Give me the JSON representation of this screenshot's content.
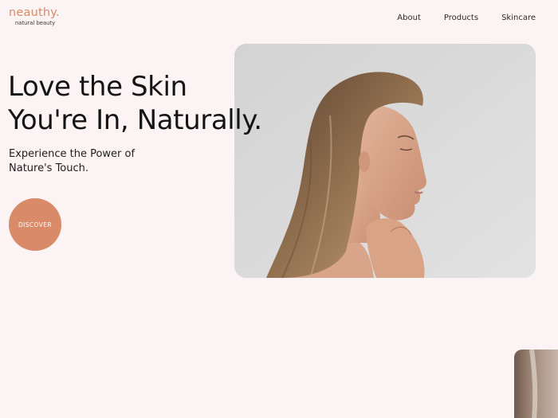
{
  "brand": {
    "name": "neauthy.",
    "tagline": "natural beauty"
  },
  "nav": {
    "items": [
      {
        "label": "About"
      },
      {
        "label": "Products"
      },
      {
        "label": "Skincare"
      }
    ]
  },
  "hero": {
    "headline_line1": "Love the Skin",
    "headline_line2": "You're In, Naturally.",
    "subhead_line1": "Experience the Power of",
    "subhead_line2": "Nature's Touch.",
    "cta_label": "DISCOVER"
  },
  "colors": {
    "background": "#fbf3f4",
    "accent": "#d98a68",
    "text": "#1c1c1c"
  }
}
